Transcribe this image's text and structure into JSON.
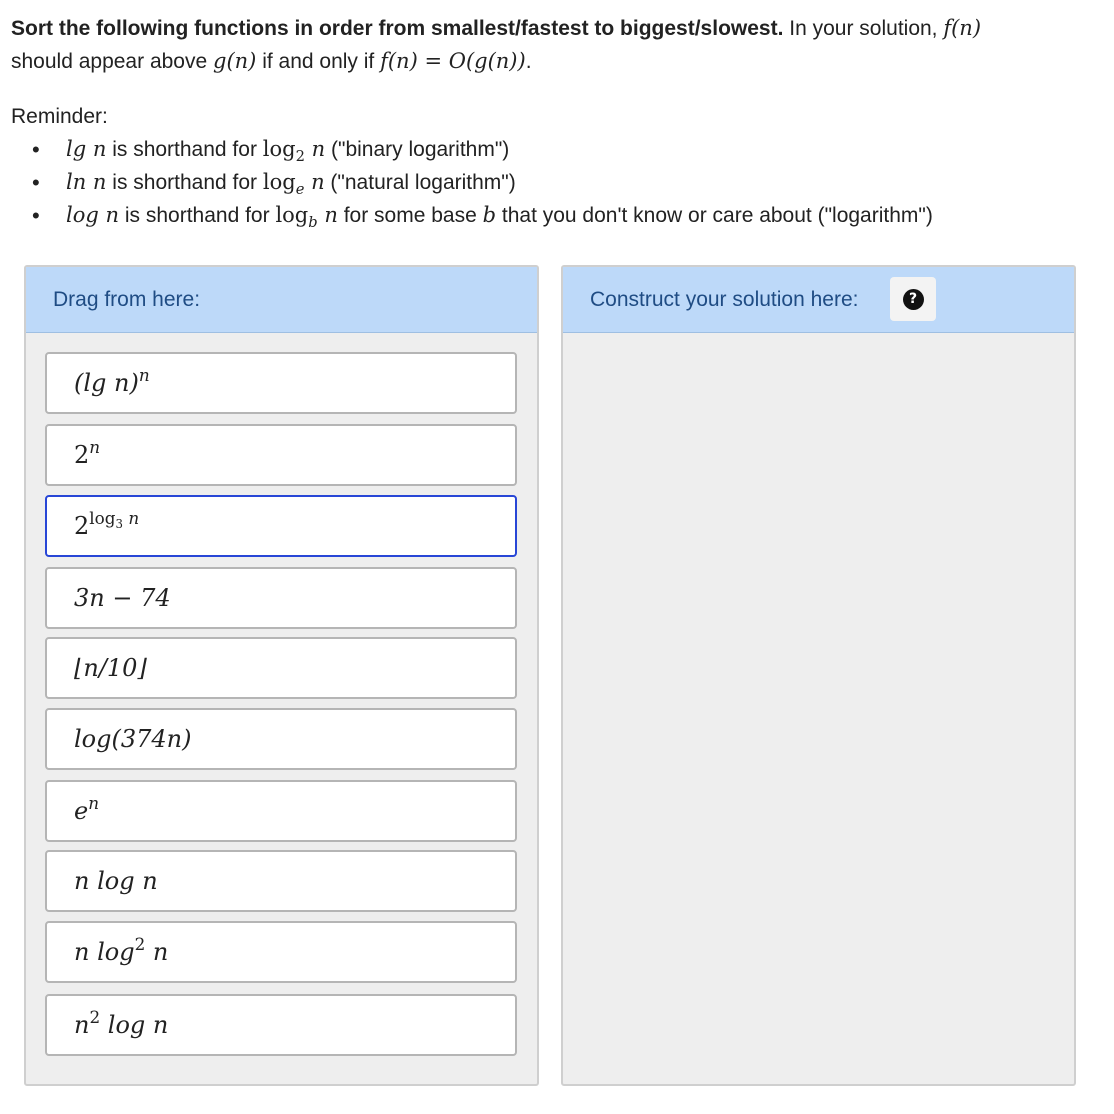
{
  "prompt": {
    "bold": "Sort the following functions in order from smallest/fastest to biggest/slowest.",
    "part1": " In your solution, ",
    "f_n": "f(n)",
    "part2": " should appear above ",
    "g_n": "g(n)",
    "part3": " if and only if ",
    "relation": "f(n) = O(g(n))",
    "part4": "."
  },
  "reminder": {
    "title": "Reminder:",
    "items": [
      {
        "math_short": "lg n",
        "text1": " is shorthand for ",
        "math_log": "log",
        "sub": "2",
        "math_var": " n",
        "text2": " (\"binary logarithm\")"
      },
      {
        "math_short": "ln n",
        "text1": " is shorthand for ",
        "math_log": "log",
        "sub": "e",
        "math_var": " n",
        "text2": " (\"natural logarithm\")"
      },
      {
        "math_short": "log n",
        "text1": " is shorthand for ",
        "math_log": "log",
        "sub": "b",
        "math_var": " n",
        "text2": " for some base ",
        "base": "b",
        "text3": " that you don't know or care about (\"logarithm\")"
      }
    ]
  },
  "drag_panel": {
    "header": "Drag from here:"
  },
  "solution_panel": {
    "header": "Construct your solution here:",
    "help_icon": "question-circle-icon",
    "help_glyph": "?"
  },
  "items": [
    {
      "id": "lgn_pow_n",
      "base": "(lg n)",
      "sup": "n"
    },
    {
      "id": "two_pow_n",
      "base": "2",
      "sup": "n"
    },
    {
      "id": "two_pow_log3n",
      "base": "2",
      "sup": "log",
      "sup_sub": "3",
      "sup_tail": " n",
      "selected": true
    },
    {
      "id": "3n_minus_74",
      "text": "3n − 74"
    },
    {
      "id": "floor_n_10",
      "text": "⌊n/10⌋"
    },
    {
      "id": "log_374n",
      "text": "log(374n)"
    },
    {
      "id": "e_pow_n",
      "base": "e",
      "sup": "n"
    },
    {
      "id": "n_log_n",
      "text": "n log n"
    },
    {
      "id": "n_log2_n",
      "pre": "n log",
      "sup": "2",
      "post": " n"
    },
    {
      "id": "n2_log_n",
      "pre": "n",
      "sup": "2",
      "post": " log n"
    }
  ],
  "colors": {
    "header_bg": "#bdd9f9",
    "header_text": "#1f4c84",
    "panel_bg": "#eeeeee",
    "selected_border": "#2846d6"
  }
}
